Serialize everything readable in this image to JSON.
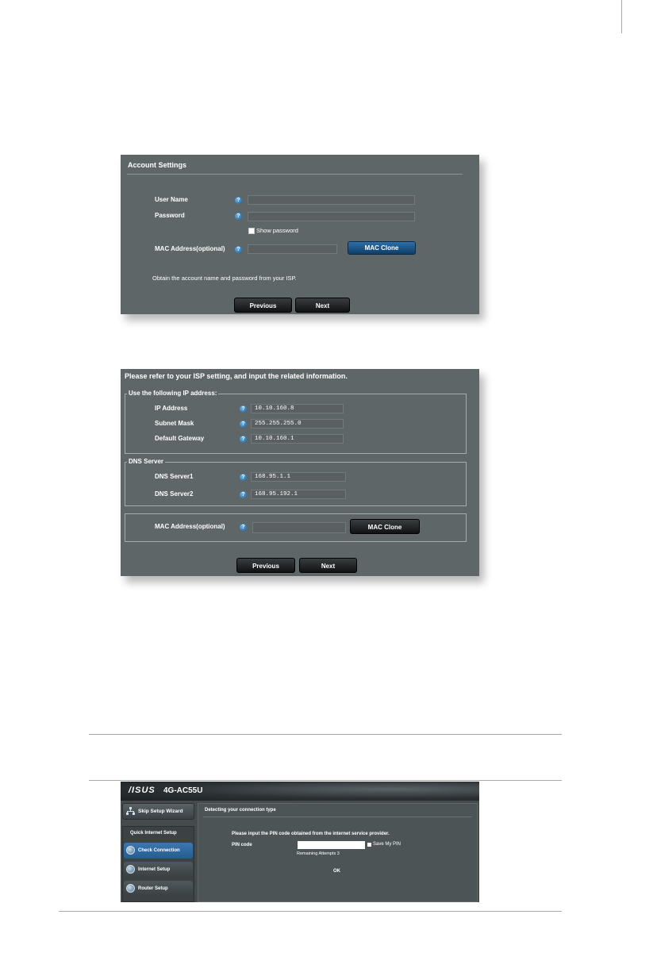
{
  "account_settings": {
    "title": "Account Settings",
    "username_label": "User Name",
    "password_label": "Password",
    "show_password_label": "Show password",
    "mac_label": "MAC Address(optional)",
    "mac_clone_label": "MAC Clone",
    "note": "Obtain the account name and password from your ISP.",
    "previous_label": "Previous",
    "next_label": "Next",
    "help_glyph": "?"
  },
  "static_ip": {
    "title": "Please refer to your ISP setting, and input the related information.",
    "ip_group_legend": "Use the following IP address:",
    "ip_address_label": "IP Address",
    "ip_address_value": "10.10.160.8",
    "subnet_mask_label": "Subnet Mask",
    "subnet_mask_value": "255.255.255.0",
    "gateway_label": "Default Gateway",
    "gateway_value": "10.10.160.1",
    "dns_group_legend": "DNS Server",
    "dns1_label": "DNS Server1",
    "dns1_value": "168.95.1.1",
    "dns2_label": "DNS Server2",
    "dns2_value": "168.95.192.1",
    "mac_label": "MAC Address(optional)",
    "mac_clone_label": "MAC Clone",
    "previous_label": "Previous",
    "next_label": "Next",
    "help_glyph": "?"
  },
  "router": {
    "logo": "/ISUS",
    "model": "4G-AC55U",
    "skip_wizard_label": "Skip Setup Wizard",
    "quick_setup_title": "Quick Internet Setup",
    "nav_check_connection": "Check Connection",
    "nav_internet_setup": "Internet Setup",
    "nav_router_setup": "Router Setup",
    "main_title": "Detecting your connection type",
    "pin_instruction": "Please input the PIN code obtained from the internet service provider.",
    "pin_label": "PIN code",
    "save_pin_label": "Save My PIN",
    "remaining_attempts": "Remaining Attempts 3",
    "ok_label": "OK"
  },
  "colors": {
    "panel_bg": "#5f6667",
    "accent_blue": "#1f5f98",
    "router_bg": "#454b4d"
  }
}
